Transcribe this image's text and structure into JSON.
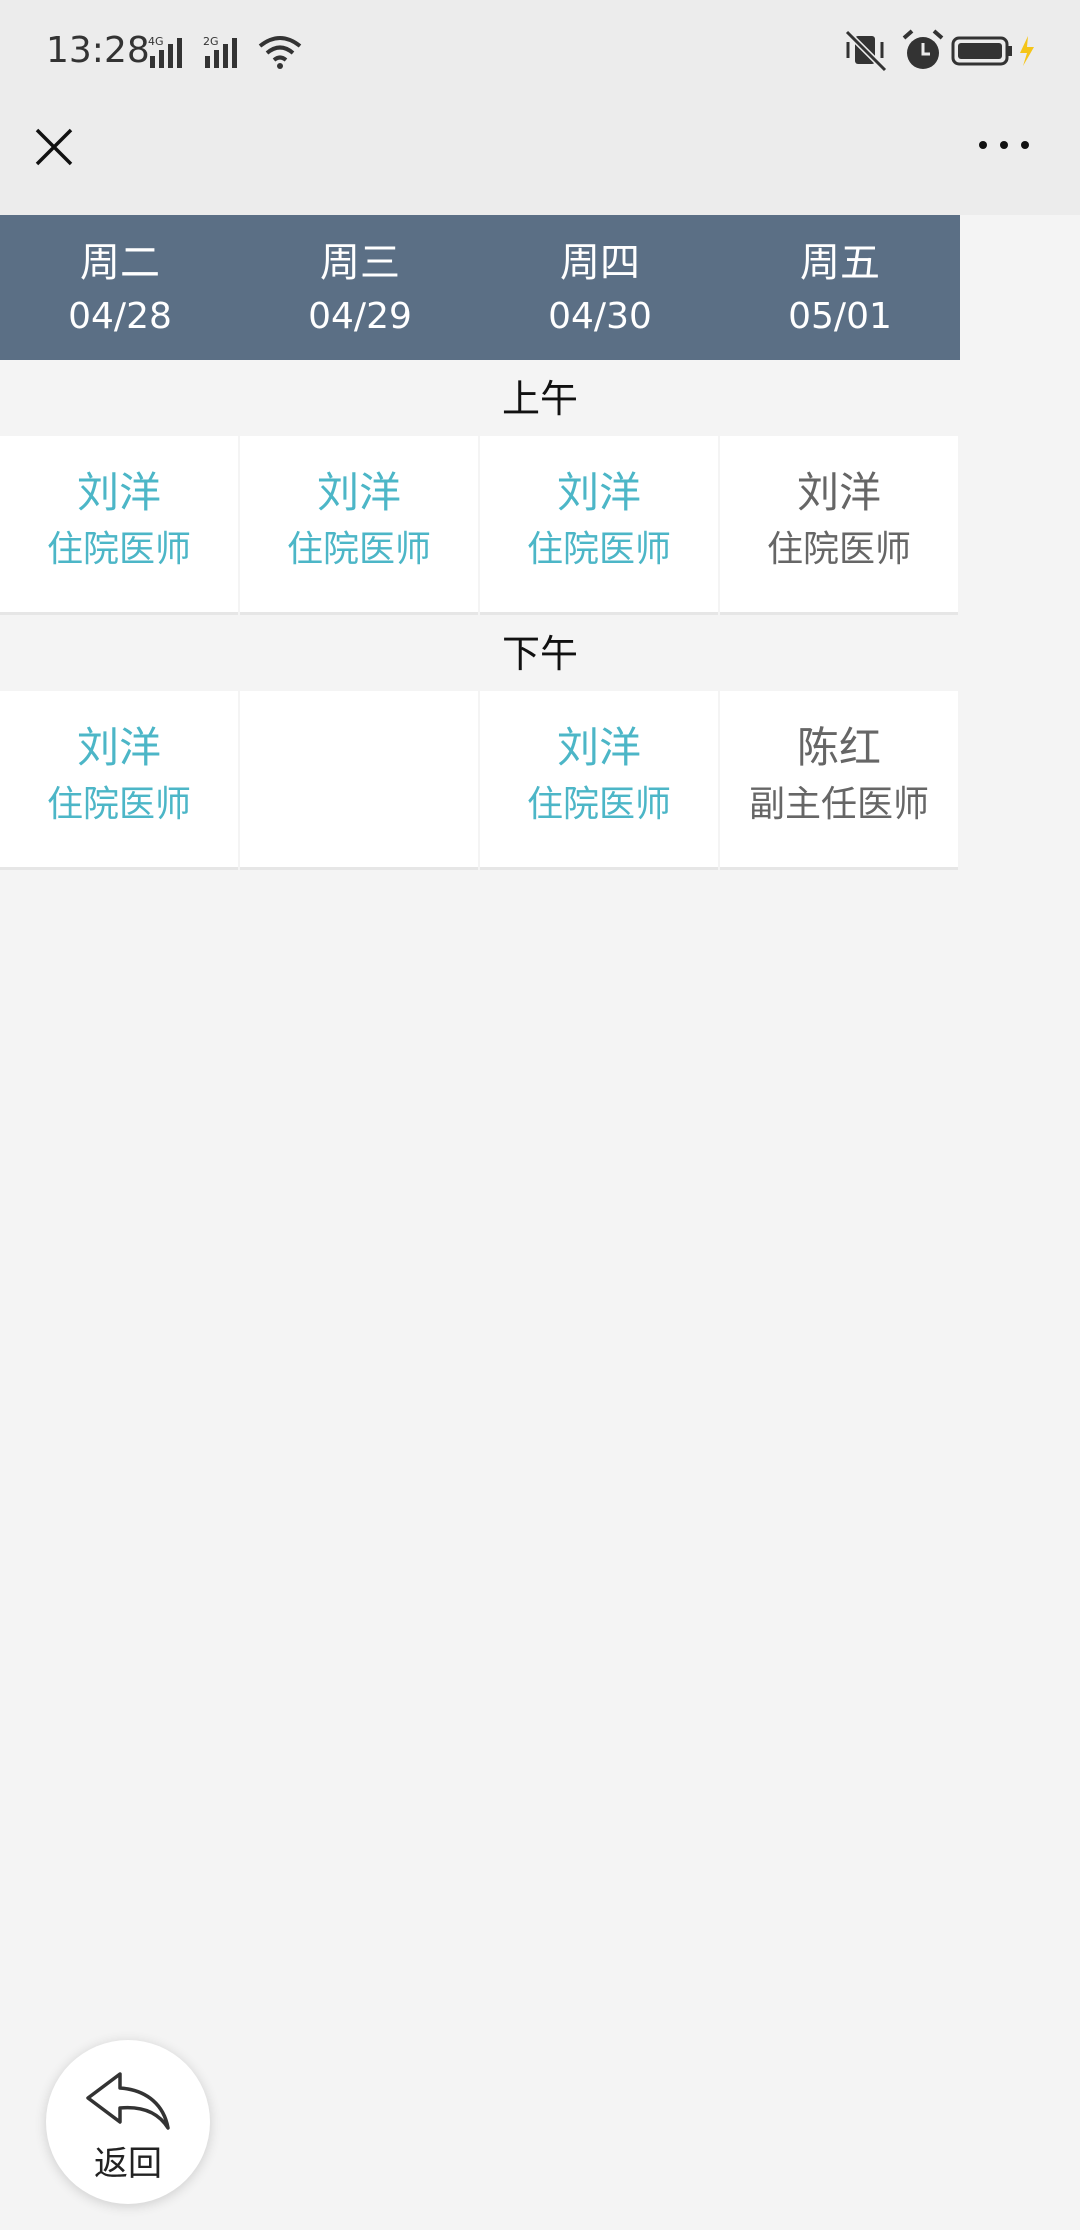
{
  "status_bar": {
    "time": "13:28",
    "net1": "4G",
    "net2": "2G"
  },
  "nav": {
    "close_icon": "close-icon",
    "more_icon": "more-icon"
  },
  "days": [
    {
      "weekday": "周二",
      "date": "04/28"
    },
    {
      "weekday": "周三",
      "date": "04/29"
    },
    {
      "weekday": "周四",
      "date": "04/30"
    },
    {
      "weekday": "周五",
      "date": "05/01"
    }
  ],
  "periods": {
    "morning": {
      "label": "上午",
      "cells": [
        {
          "name": "刘洋",
          "title": "住院医师",
          "color": "#4cb6c7"
        },
        {
          "name": "刘洋",
          "title": "住院医师",
          "color": "#4cb6c7"
        },
        {
          "name": "刘洋",
          "title": "住院医师",
          "color": "#4cb6c7"
        },
        {
          "name": "刘洋",
          "title": "住院医师",
          "color": "#666666"
        }
      ]
    },
    "afternoon": {
      "label": "下午",
      "cells": [
        {
          "name": "刘洋",
          "title": "住院医师",
          "color": "#4cb6c7"
        },
        {
          "name": "",
          "title": "",
          "color": "#4cb6c7"
        },
        {
          "name": "刘洋",
          "title": "住院医师",
          "color": "#4cb6c7"
        },
        {
          "name": "陈红",
          "title": "副主任医师",
          "color": "#666666"
        }
      ]
    }
  },
  "back_button": {
    "label": "返回"
  },
  "colors": {
    "header_bg": "#5b6f85",
    "accent": "#4cb6c7",
    "muted": "#666666",
    "page_bg": "#f4f4f4"
  }
}
